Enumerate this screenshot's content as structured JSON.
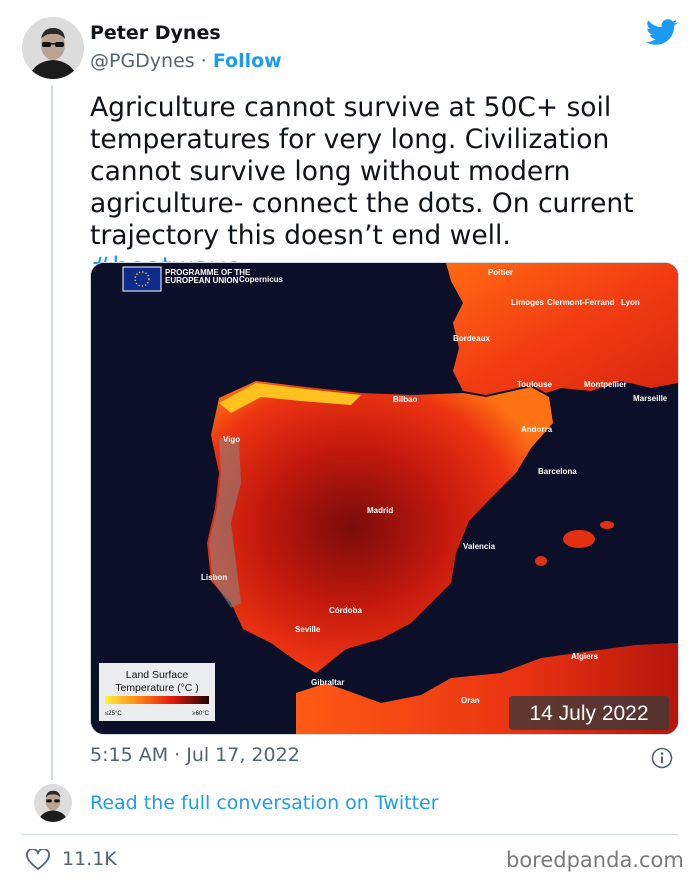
{
  "author": {
    "name": "Peter Dynes",
    "handle": "@PGDynes",
    "separator": "·",
    "follow_label": "Follow"
  },
  "tweet": {
    "text": "Agriculture cannot survive at 50C+ soil temperatures for very long. Civilization cannot survive long without modern agriculture- connect the dots. On current trajectory this doesn’t end well.",
    "hashtag": "#heatwave",
    "timestamp": "5:15 AM · Jul 17, 2022"
  },
  "media": {
    "logo_text_1": "PROGRAMME OF THE",
    "logo_text_2": "EUROPEAN UNION",
    "brand": "Copernicus",
    "date_badge": "14 July 2022",
    "legend_title_1": "Land Surface",
    "legend_title_2": "Temperature (°C )",
    "legend_min": "≤25°C",
    "legend_max": "≥60°C",
    "places": {
      "poitier": "Poitier",
      "limoges": "Limoges",
      "clermont": "Clermont-Ferrand",
      "lyon": "Lyon",
      "bordeaux": "Bordeaux",
      "toulouse": "Toulouse",
      "montpellier": "Montpellier",
      "marseille": "Marseille",
      "bilbao": "Bilbao",
      "andorra": "Andorra",
      "vigo": "Vigo",
      "barcelona": "Barcelona",
      "madrid": "Madrid",
      "valencia": "Valencia",
      "lisbon": "Lisbon",
      "cordoba": "Córdoba",
      "seville": "Seville",
      "algiers": "Algiers",
      "gibraltar": "Gibraltar",
      "oran": "Oran"
    },
    "colors": {
      "sea": "#0b0f28",
      "hot": "#e8260e",
      "warm": "#ff7a10",
      "cool": "#ffe23a"
    }
  },
  "footer": {
    "read_more": "Read the full conversation on Twitter",
    "likes": "11.1K",
    "watermark": "boredpanda.com"
  },
  "icons": [
    "twitter-bird-icon",
    "info-icon",
    "heart-icon"
  ]
}
